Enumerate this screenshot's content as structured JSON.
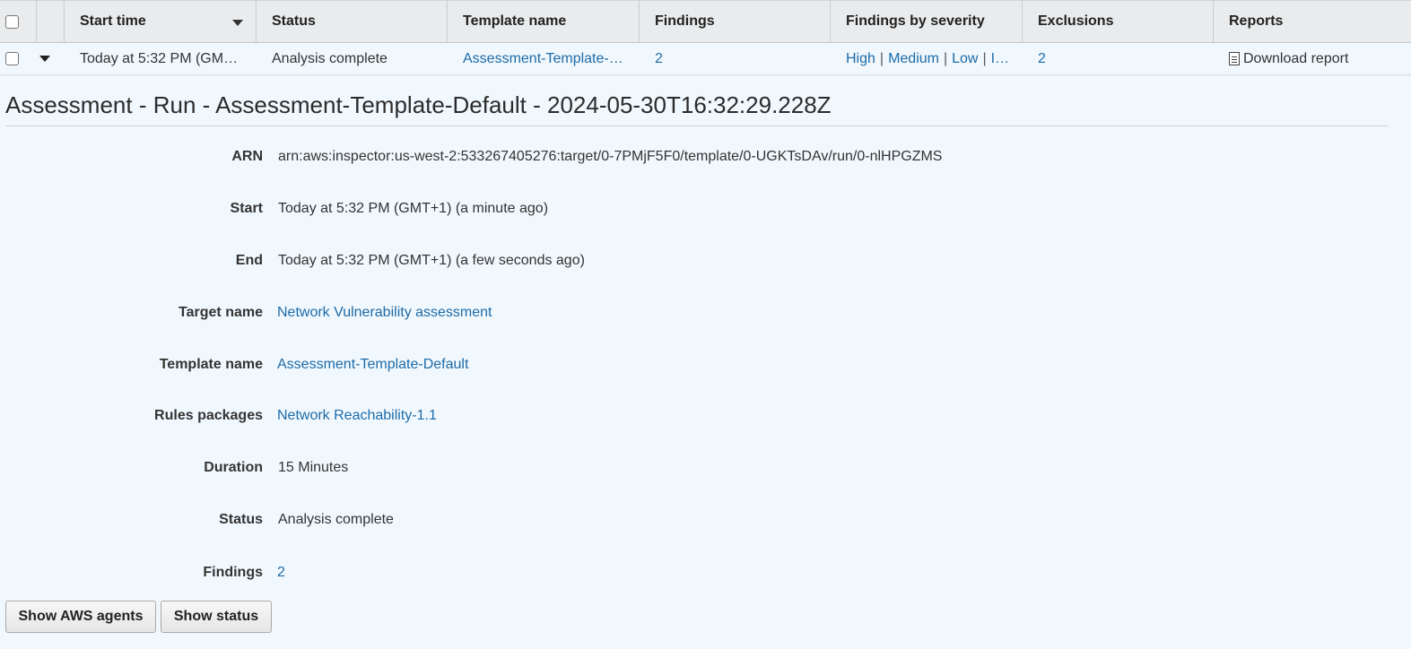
{
  "table": {
    "headers": {
      "start_time": "Start time",
      "status": "Status",
      "template_name": "Template name",
      "findings": "Findings",
      "findings_by_severity": "Findings by severity",
      "exclusions": "Exclusions",
      "reports": "Reports"
    },
    "row": {
      "start_time": "Today at 5:32 PM (GM…",
      "status": "Analysis complete",
      "template_name": "Assessment-Template-…",
      "findings": "2",
      "severity": {
        "high": "High",
        "medium": "Medium",
        "low": "Low",
        "info": "I…",
        "separator": "|"
      },
      "exclusions": "2",
      "report_link": "Download report"
    }
  },
  "detail": {
    "title": "Assessment - Run - Assessment-Template-Default - 2024-05-30T16:32:29.228Z",
    "arn_label": "ARN",
    "arn_value": "arn:aws:inspector:us-west-2:533267405276:target/0-7PMjF5F0/template/0-UGKTsDAv/run/0-nlHPGZMS",
    "start_label": "Start",
    "start_value": "Today at 5:32 PM (GMT+1) (a minute ago)",
    "end_label": "End",
    "end_value": "Today at 5:32 PM (GMT+1) (a few seconds ago)",
    "target_label": "Target name",
    "target_value": "Network Vulnerability assessment",
    "template_label": "Template name",
    "template_value": "Assessment-Template-Default",
    "rules_label": "Rules packages",
    "rules_value": "Network Reachability-1.1",
    "duration_label": "Duration",
    "duration_value": "15 Minutes",
    "status_label": "Status",
    "status_value": "Analysis complete",
    "findings_label": "Findings",
    "findings_value": "2"
  },
  "buttons": {
    "show_agents": "Show AWS agents",
    "show_status": "Show status"
  },
  "icons": {
    "sort": "caret-down-icon",
    "expand": "caret-down-icon",
    "report": "document-icon"
  },
  "colors": {
    "link": "#1d6ba8",
    "background": "#f1f8fd",
    "header_bg": "#e9ebed"
  }
}
